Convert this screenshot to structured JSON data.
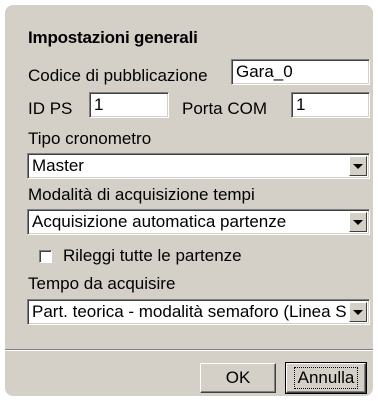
{
  "section": {
    "title": "Impostazioni generali"
  },
  "publication": {
    "label": "Codice di pubblicazione",
    "value": "Gara_0"
  },
  "id_ps": {
    "label": "ID PS",
    "value": "1"
  },
  "com_port": {
    "label": "Porta COM",
    "value": "1"
  },
  "timer_type": {
    "label": "Tipo cronometro",
    "selected": "Master"
  },
  "acquisition_mode": {
    "label": "Modalità di acquisizione tempi",
    "selected": "Acquisizione automatica partenze"
  },
  "reread": {
    "label": "Rileggi tutte le partenze",
    "checked": false
  },
  "time_to_acquire": {
    "label": "Tempo da acquisire",
    "selected": "Part. teorica - modalità semaforo (Linea S"
  },
  "buttons": {
    "ok": "OK",
    "cancel": "Annulla"
  },
  "colors": {
    "panel_bg": "#d4d0c8",
    "field_bg": "#ffffff"
  },
  "icons": {
    "dropdown": "chevron-down-icon"
  }
}
